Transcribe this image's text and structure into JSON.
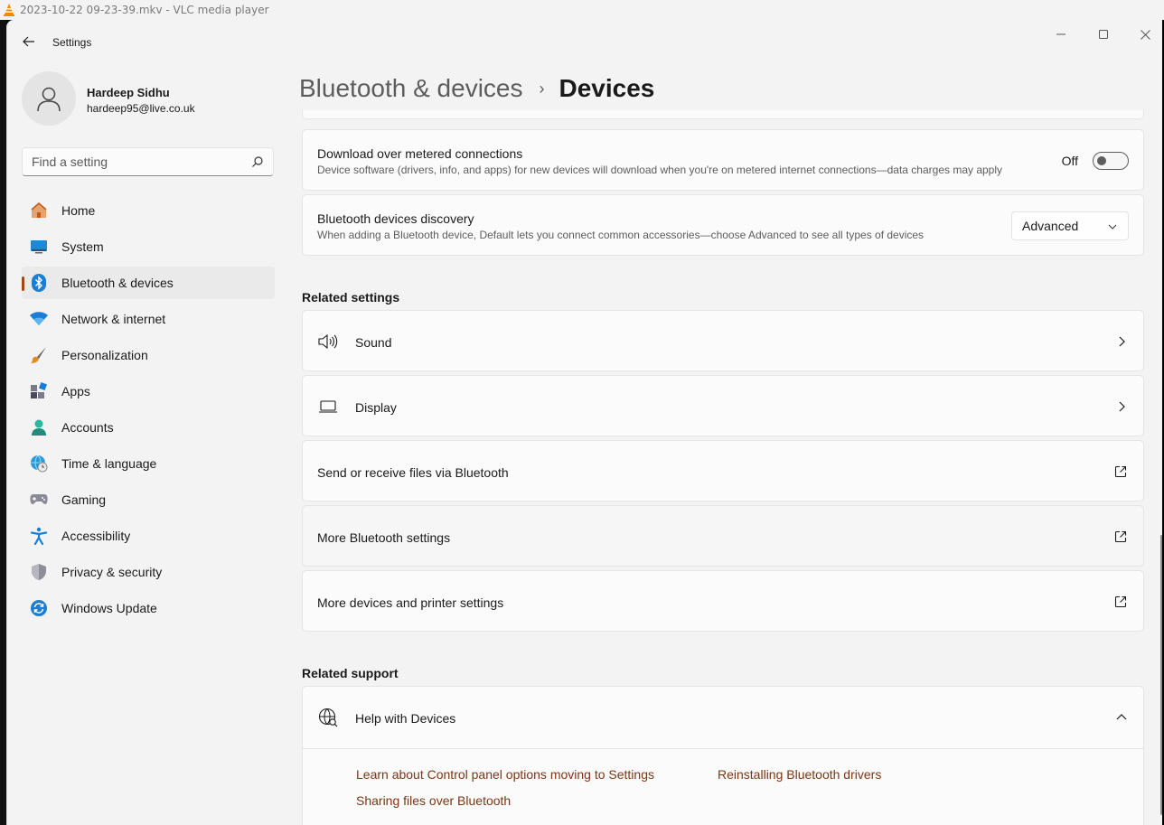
{
  "background_window": {
    "title": "2023-10-22 09-23-39.mkv - VLC media player"
  },
  "window": {
    "title": "Settings"
  },
  "user": {
    "name": "Hardeep Sidhu",
    "email": "hardeep95@live.co.uk"
  },
  "search": {
    "placeholder": "Find a setting"
  },
  "sidebar": {
    "items": [
      {
        "label": "Home",
        "icon": "home-icon"
      },
      {
        "label": "System",
        "icon": "system-icon"
      },
      {
        "label": "Bluetooth & devices",
        "icon": "bluetooth-icon",
        "active": true
      },
      {
        "label": "Network & internet",
        "icon": "wifi-icon"
      },
      {
        "label": "Personalization",
        "icon": "brush-icon"
      },
      {
        "label": "Apps",
        "icon": "apps-icon"
      },
      {
        "label": "Accounts",
        "icon": "accounts-icon"
      },
      {
        "label": "Time & language",
        "icon": "globe-clock-icon"
      },
      {
        "label": "Gaming",
        "icon": "gamepad-icon"
      },
      {
        "label": "Accessibility",
        "icon": "accessibility-icon"
      },
      {
        "label": "Privacy & security",
        "icon": "shield-icon"
      },
      {
        "label": "Windows Update",
        "icon": "update-icon"
      }
    ]
  },
  "breadcrumb": {
    "parent": "Bluetooth & devices",
    "separator": "›",
    "current": "Devices"
  },
  "settings": {
    "metered": {
      "title": "Download over metered connections",
      "description": "Device software (drivers, info, and apps) for new devices will download when you're on metered internet connections—data charges may apply",
      "state_label": "Off",
      "enabled": false
    },
    "discovery": {
      "title": "Bluetooth devices discovery",
      "description": "When adding a Bluetooth device, Default lets you connect common accessories—choose Advanced to see all types of devices",
      "selected": "Advanced"
    }
  },
  "related_settings": {
    "heading": "Related settings",
    "items": [
      {
        "label": "Sound",
        "icon": "speaker-icon",
        "action": "chevron"
      },
      {
        "label": "Display",
        "icon": "laptop-icon",
        "action": "chevron"
      },
      {
        "label": "Send or receive files via Bluetooth",
        "action": "external"
      },
      {
        "label": "More Bluetooth settings",
        "action": "external"
      },
      {
        "label": "More devices and printer settings",
        "action": "external"
      }
    ]
  },
  "related_support": {
    "heading": "Related support",
    "help_title": "Help with Devices",
    "links": [
      "Learn about Control panel options moving to Settings",
      "Reinstalling Bluetooth drivers",
      "Sharing files over Bluetooth"
    ]
  },
  "colors": {
    "accent": "#9e4a10",
    "link": "#7c3614",
    "window_bg": "#f3f3f3",
    "card_bg": "#fbfbfb"
  }
}
